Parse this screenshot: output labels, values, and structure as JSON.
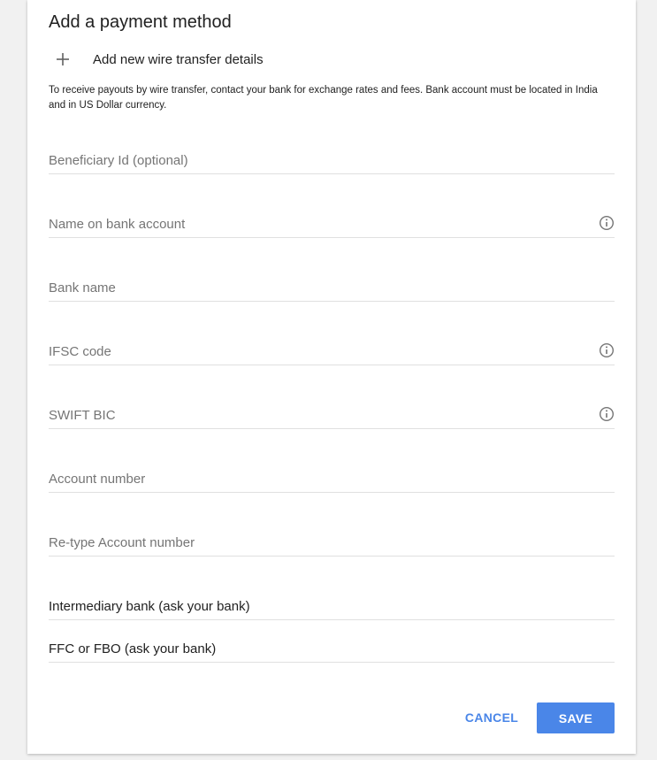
{
  "dialog": {
    "title": "Add a payment method",
    "add_option_label": "Add new wire transfer details",
    "info_text": "To receive payouts by wire transfer, contact your bank for exchange rates and fees. Bank account must be located in India and in US Dollar currency."
  },
  "fields": {
    "beneficiary_id": {
      "placeholder": "Beneficiary Id (optional)",
      "value": ""
    },
    "name_on_account": {
      "placeholder": "Name on bank account",
      "value": ""
    },
    "bank_name": {
      "placeholder": "Bank name",
      "value": ""
    },
    "ifsc_code": {
      "placeholder": "IFSC code",
      "value": ""
    },
    "swift_bic": {
      "placeholder": "SWIFT BIC",
      "value": ""
    },
    "account_number": {
      "placeholder": "Account number",
      "value": ""
    },
    "retype_account_number": {
      "placeholder": "Re-type Account number",
      "value": ""
    },
    "intermediary_bank": {
      "placeholder": "Intermediary bank (ask your bank)",
      "value": ""
    },
    "ffc_fbo": {
      "placeholder": "FFC or FBO (ask your bank)",
      "value": ""
    }
  },
  "icons": {
    "add": "plus-icon",
    "info": "info-icon"
  },
  "actions": {
    "cancel_label": "CANCEL",
    "save_label": "SAVE"
  },
  "colors": {
    "accent": "#4a86e8",
    "background": "#f1f1f1",
    "card": "#ffffff",
    "divider": "#e0e0e0"
  }
}
